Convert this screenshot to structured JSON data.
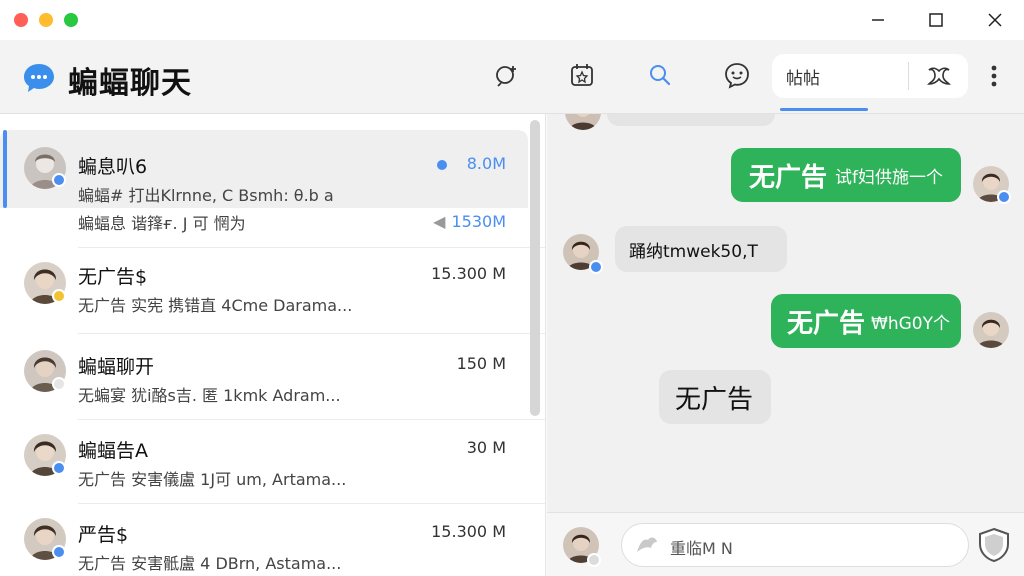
{
  "window": {
    "traffic_lights": {
      "close": "#ff5f57",
      "minimize": "#febc2e",
      "zoom": "#28c840"
    }
  },
  "header": {
    "app_title": "蝙蝠聊天",
    "icons": [
      "add-contact-icon",
      "calendar-icon",
      "search-icon",
      "chat-emoji-icon"
    ],
    "segment_tab_label": "帖帖",
    "accent_color": "#4a8ef0"
  },
  "conversations": [
    {
      "name": "蝙息叭6",
      "preview": "蝙蝠# 打出Klrnnе, C Bsmh: θ.b a",
      "meta": "8.0M",
      "dot": true,
      "active": true
    },
    {
      "name": "",
      "preview": "蝙蝠息 谐箨ғ. J 可 惘为",
      "meta": "1530M",
      "dot": false,
      "active": false
    },
    {
      "name": "无广告$",
      "preview": "无广告 实宪 携错直 4Cme Darama...",
      "meta": "15.300 M",
      "dot": false,
      "active": false
    },
    {
      "name": "蝙蝠聊开",
      "preview": "无蝙宴 犹i酪s吉. 匿 1kmk Adram...",
      "meta": "150 M",
      "dot": false,
      "active": false
    },
    {
      "name": "蝙蝠告A",
      "preview": "无广告 安害儀盧 1J可 um, Artama...",
      "meta": "30 M",
      "dot": false,
      "active": false
    },
    {
      "name": "严告$",
      "preview": "无广告 安害骶盧 4 DBrn, Astama...",
      "meta": "15.300 M",
      "dot": false,
      "active": false
    }
  ],
  "messages": [
    {
      "side": "right",
      "text": "无广告 试f妇供施一个",
      "lead": "无广告",
      "rest": "试f妇供施一个"
    },
    {
      "side": "left",
      "text": "踊纳tmwek50,T"
    },
    {
      "side": "right",
      "text": "无广告 ₩hG0Y个",
      "lead": "无广告",
      "rest": "₩hG0Y个"
    },
    {
      "side": "left",
      "text": "无广告"
    }
  ],
  "composer": {
    "placeholder": "重临M N",
    "shield_icon": "shield-icon"
  },
  "colors": {
    "green_bubble": "#2fb35a",
    "gray_bubble": "#e4e4e4",
    "accent_blue": "#4a8ef0"
  }
}
